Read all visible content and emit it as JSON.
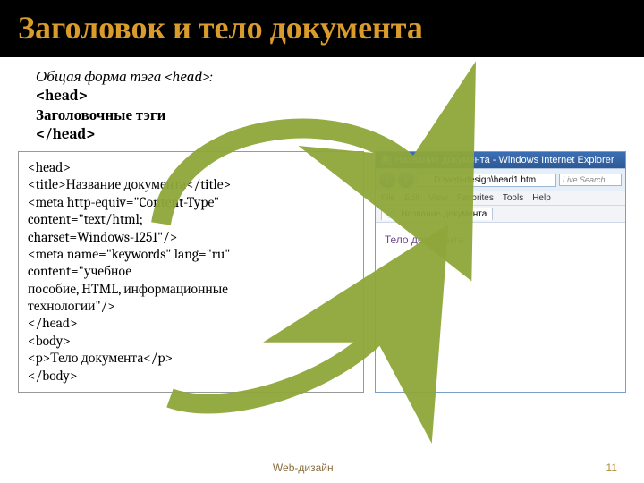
{
  "title": "Заголовок и тело документа",
  "intro": {
    "line1": "Общая форма тэга <head>:",
    "line2": "<head>",
    "line3": "Заголовочные тэги",
    "line4": "</head>"
  },
  "code": {
    "l1": "<head>",
    "l2": "<title>Название документа</title>",
    "l3": "<meta http-equiv=\"Content-Type\"",
    "l4": "  content=\"text/html;",
    "l5": "  charset=Windows-1251\"/>",
    "l6": "<meta name=\"keywords\" lang=\"ru\"",
    "l7": "  content=\"учебное",
    "l8": "  пособие, HTML, информационные",
    "l9": "  технологии\"/>",
    "l10": "</head>",
    "l11": "<body>",
    "l12": "<p>Тело документа</p>",
    "l13": "</body>"
  },
  "browser": {
    "title": "Название документа - Windows Internet Explorer",
    "address": "D:\\web-design\\head1.htm",
    "search_placeholder": "Live Search",
    "menu": {
      "file": "File",
      "edit": "Edit",
      "view": "View",
      "favorites": "Favorites",
      "tools": "Tools",
      "help": "Help"
    },
    "tab": "Название документа",
    "body_text": "Тело документа"
  },
  "footer": {
    "label": "Web-дизайн",
    "page": "11"
  },
  "icons": {
    "back": "‹",
    "forward": "›",
    "e": "e",
    "page": "📄"
  }
}
